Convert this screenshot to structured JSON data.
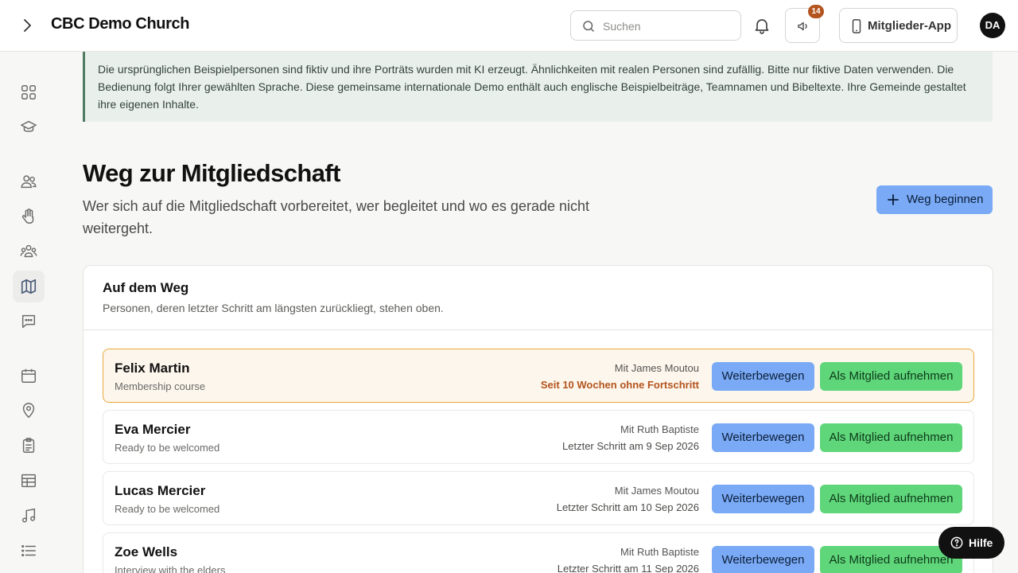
{
  "header": {
    "brand": "CBC Demo Church",
    "search_placeholder": "Suchen",
    "announcement_count": "14",
    "member_app_label": "Mitglieder-App",
    "avatar_initials": "DA"
  },
  "sidebar": {
    "items": [
      {
        "icon": "grid-icon"
      },
      {
        "icon": "graduation-cap-icon"
      },
      {
        "icon": "people-icon"
      },
      {
        "icon": "hand-icon"
      },
      {
        "icon": "groups-icon"
      },
      {
        "icon": "map-icon",
        "active": true
      },
      {
        "icon": "chat-icon"
      },
      {
        "icon": "calendar-icon"
      },
      {
        "icon": "location-pin-icon"
      },
      {
        "icon": "clipboard-icon"
      },
      {
        "icon": "table-icon"
      },
      {
        "icon": "music-note-icon"
      },
      {
        "icon": "list-icon"
      }
    ]
  },
  "notice": "Die ursprünglichen Beispielpersonen sind fiktiv und ihre Porträts wurden mit KI erzeugt. Ähnlichkeiten mit realen Personen sind zufällig. Bitte nur fiktive Daten verwenden. Die Bedienung folgt Ihrer gewählten Sprache. Diese gemeinsame internationale Demo enthält auch englische Beispielbeiträge, Teamnamen und Bibeltexte. Ihre Gemeinde gestaltet ihre eigenen Inhalte.",
  "page": {
    "title": "Weg zur Mitgliedschaft",
    "subtitle": "Wer sich auf die Mitgliedschaft vorbereitet, wer begleitet und wo es gerade nicht weitergeht.",
    "start_button": "Weg beginnen"
  },
  "card": {
    "title": "Auf dem Weg",
    "subtitle": "Personen, deren letzter Schritt am längsten zurückliegt, stehen oben.",
    "move_label": "Weiterbewegen",
    "admit_label": "Als Mitglied aufnehmen",
    "rows": [
      {
        "name": "Felix Martin",
        "step": "Membership course",
        "mentor": "Mit James Moutou",
        "status": "Seit 10 Wochen ohne Fortschritt",
        "stale": true
      },
      {
        "name": "Eva Mercier",
        "step": "Ready to be welcomed",
        "mentor": "Mit Ruth Baptiste",
        "status": "Letzter Schritt am 9 Sep 2026",
        "stale": false
      },
      {
        "name": "Lucas Mercier",
        "step": "Ready to be welcomed",
        "mentor": "Mit James Moutou",
        "status": "Letzter Schritt am 10 Sep 2026",
        "stale": false
      },
      {
        "name": "Zoe Wells",
        "step": "Interview with the elders",
        "mentor": "Mit Ruth Baptiste",
        "status": "Letzter Schritt am 11 Sep 2026",
        "stale": false
      }
    ]
  },
  "help_label": "Hilfe",
  "colors": {
    "primary_button": "#7aaaf5",
    "admit_button": "#5fd67a",
    "stale_accent": "#b3541e",
    "notice_bg": "#e9f0ec"
  }
}
